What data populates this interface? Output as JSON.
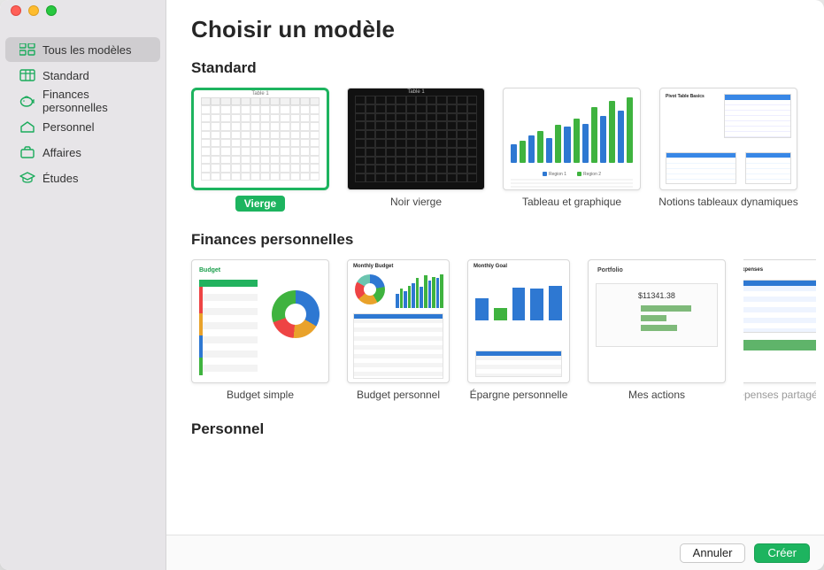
{
  "window": {
    "title": "Choisir un modèle"
  },
  "sidebar": {
    "items": [
      {
        "id": "all",
        "label": "Tous les modèles",
        "icon": "grid"
      },
      {
        "id": "standard",
        "label": "Standard",
        "icon": "table"
      },
      {
        "id": "finances",
        "label": "Finances personnelles",
        "icon": "piggy"
      },
      {
        "id": "personnel",
        "label": "Personnel",
        "icon": "house"
      },
      {
        "id": "affaires",
        "label": "Affaires",
        "icon": "briefcase"
      },
      {
        "id": "etudes",
        "label": "Études",
        "icon": "cap"
      }
    ],
    "selected": "all"
  },
  "sections": [
    {
      "id": "standard",
      "title": "Standard",
      "templates": [
        {
          "id": "blank",
          "label": "Vierge",
          "selected": true
        },
        {
          "id": "blank-dark",
          "label": "Noir vierge"
        },
        {
          "id": "chart",
          "label": "Tableau et graphique"
        },
        {
          "id": "pivot",
          "label": "Notions tableaux dynamiques"
        }
      ]
    },
    {
      "id": "finances",
      "title": "Finances personnelles",
      "templates": [
        {
          "id": "budget-simple",
          "label": "Budget simple"
        },
        {
          "id": "budget-perso",
          "label": "Budget personnel"
        },
        {
          "id": "epargne",
          "label": "Épargne personnelle"
        },
        {
          "id": "actions",
          "label": "Mes actions"
        },
        {
          "id": "depenses",
          "label": "Dépenses partagées"
        }
      ]
    },
    {
      "id": "personnel",
      "title": "Personnel",
      "templates": []
    }
  ],
  "thumb_text": {
    "table_title": "Table 1",
    "pivot_title": "Pivot Table Basics",
    "budget_title": "Budget",
    "monthly_budget": "Monthly Budget",
    "monthly_goal": "Monthly Goal",
    "portfolio": "Portfolio",
    "portfolio_value": "$11341.38",
    "shared": "Shared Expenses",
    "legend_a": "Region 1",
    "legend_b": "Region 2"
  },
  "footer": {
    "cancel": "Annuler",
    "create": "Créer"
  },
  "colors": {
    "accent": "#1db45f",
    "blue": "#2e78d2",
    "green": "#3fb33f"
  }
}
